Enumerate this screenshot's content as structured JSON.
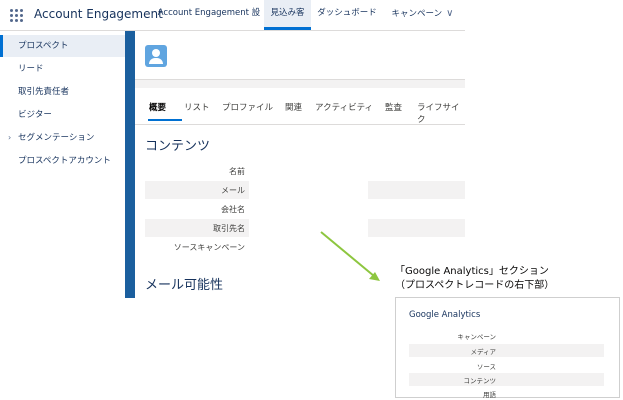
{
  "topbar": {
    "app_name": "Account Engagement",
    "tabs": [
      {
        "label": "Account Engagement 設定",
        "active": false
      },
      {
        "label": "見込み客",
        "active": true
      },
      {
        "label": "ダッシュボード",
        "active": false
      },
      {
        "label": "キャンペーン",
        "active": false
      }
    ]
  },
  "sidebar": {
    "items": [
      {
        "label": "プロスペクト",
        "active": true
      },
      {
        "label": "リード",
        "active": false
      },
      {
        "label": "取引先責任者",
        "active": false
      },
      {
        "label": "ビジター",
        "active": false
      },
      {
        "label": "セグメンテーション",
        "active": false,
        "expandable": true
      },
      {
        "label": "プロスペクトアカウント",
        "active": false
      }
    ]
  },
  "record": {
    "tabs": [
      "概要",
      "リスト",
      "プロファイル",
      "関連",
      "アクティビティ",
      "監査",
      "ライフサイク"
    ],
    "active_tab": "概要",
    "section_contents": "コンテンツ",
    "fields": [
      "名前",
      "メール",
      "会社名",
      "取引先名",
      "ソースキャンペーン"
    ],
    "section_mail": "メール可能性"
  },
  "annotation": {
    "line1": "「Google Analytics」セクション",
    "line2": "（プロスペクトレコードの右下部）",
    "arrow_color": "#8dc63f"
  },
  "inset": {
    "title": "Google Analytics",
    "fields": [
      "キャンペーン",
      "メディア",
      "ソース",
      "コンテンツ",
      "用語"
    ]
  },
  "colors": {
    "accent": "#0070d2",
    "sidebar_active_bg": "#e9eef5",
    "content_edge": "#1b5f9e"
  }
}
